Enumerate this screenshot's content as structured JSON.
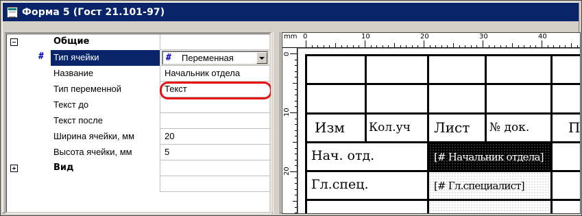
{
  "window": {
    "title": "Форма 5 (Гост 21.101-97)"
  },
  "props": {
    "groups": [
      {
        "label": "Общие",
        "expander": "minus"
      },
      {
        "label": "Вид",
        "expander": "plus"
      }
    ],
    "rows": [
      {
        "marker": "#",
        "name": "Тип ячейки",
        "value": "Переменная",
        "selected": true
      },
      {
        "name": "Название",
        "value": "Начальник отдела"
      },
      {
        "name": "Тип переменной",
        "value": "Текст"
      },
      {
        "name": "Текст до",
        "value": ""
      },
      {
        "name": "Текст после",
        "value": ""
      },
      {
        "name": "Ширина ячейки, мм",
        "value": "20"
      },
      {
        "name": "Высота ячейки, мм",
        "value": "5"
      }
    ],
    "combo_marker": "#"
  },
  "designer": {
    "ruler_unit": "mm",
    "ruler_top_numbers": [
      "0",
      "10",
      "20",
      "30",
      "40"
    ],
    "ruler_left_numbers": [
      "0",
      "10",
      "20"
    ],
    "header_cells": [
      "Изм",
      "Кол.уч",
      "Лист",
      "№ док.",
      "П"
    ],
    "rows": [
      {
        "label": "Нач. отд.",
        "variable": "[# Начальник отдела]"
      },
      {
        "label": "Гл.спец.",
        "variable": "[# Гл.специалист]"
      }
    ]
  }
}
